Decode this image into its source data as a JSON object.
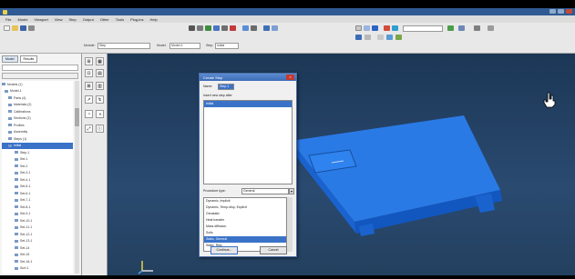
{
  "window": {
    "title": ""
  },
  "menubar": {
    "items": [
      "File",
      "Model",
      "Viewport",
      "View",
      "Step",
      "Output",
      "Other",
      "Tools",
      "Plug-ins",
      "Help"
    ]
  },
  "toolbar": {
    "module_label": "Module:",
    "module_value": "Step",
    "model_label": "Model:",
    "model_value": "Model-1",
    "step_label": "Step:",
    "step_value": "Initial"
  },
  "left_panel": {
    "tabs": [
      "Model",
      "Results"
    ],
    "tree_items": [
      {
        "label": "Models (1)",
        "selected": false
      },
      {
        "label": "Model-1",
        "selected": false
      },
      {
        "label": "Parts (4)",
        "selected": false
      },
      {
        "label": "Materials (2)",
        "selected": false
      },
      {
        "label": "Calibrations",
        "selected": false
      },
      {
        "label": "Sections (2)",
        "selected": false
      },
      {
        "label": "Profiles",
        "selected": false
      },
      {
        "label": "Assembly",
        "selected": false
      },
      {
        "label": "Steps (1)",
        "selected": false
      },
      {
        "label": "Initial",
        "selected": true
      },
      {
        "label": "Step-1",
        "selected": false
      },
      {
        "label": "Set-1",
        "selected": false
      },
      {
        "label": "Set-2",
        "selected": false
      },
      {
        "label": "Set-3-1",
        "selected": false
      },
      {
        "label": "Set-4-1",
        "selected": false
      },
      {
        "label": "Set-5-1",
        "selected": false
      },
      {
        "label": "Set-6-1",
        "selected": false
      },
      {
        "label": "Set-7-1",
        "selected": false
      },
      {
        "label": "Set-8-1",
        "selected": false
      },
      {
        "label": "Set-9-1",
        "selected": false
      },
      {
        "label": "Set-10-1",
        "selected": false
      },
      {
        "label": "Set-11-1",
        "selected": false
      },
      {
        "label": "Set-12-1",
        "selected": false
      },
      {
        "label": "Set-13-1",
        "selected": false
      },
      {
        "label": "Set-14",
        "selected": false
      },
      {
        "label": "Set-15",
        "selected": false
      },
      {
        "label": "Set-16-1",
        "selected": false
      },
      {
        "label": "Surf-1",
        "selected": false
      },
      {
        "label": "Fields Output Requests",
        "selected": false
      },
      {
        "label": "Field Output (1)",
        "selected": false
      }
    ]
  },
  "dialog": {
    "title": "Create Step",
    "name_label": "Name:",
    "name_value": "Step-1",
    "insert_label": "Insert new step after",
    "insert_list": [
      {
        "label": "Initial",
        "selected": true
      }
    ],
    "procedure_label": "Procedure type:",
    "procedure_value": "General",
    "procedure_list": [
      {
        "label": "Dynamic, Implicit",
        "selected": false
      },
      {
        "label": "Dynamic, Temp-disp, Explicit",
        "selected": false
      },
      {
        "label": "Geostatic",
        "selected": false
      },
      {
        "label": "Heat transfer",
        "selected": false
      },
      {
        "label": "Mass diffusion",
        "selected": false
      },
      {
        "label": "Soils",
        "selected": false
      },
      {
        "label": "Static, General",
        "selected": true
      },
      {
        "label": "Static, Riks",
        "selected": false
      }
    ],
    "continue_label": "Continue...",
    "cancel_label": "Cancel"
  },
  "colors": {
    "model_blue": "#1f6fe0",
    "viewport_bg": "#1c3756",
    "selection": "#3a72c8"
  }
}
